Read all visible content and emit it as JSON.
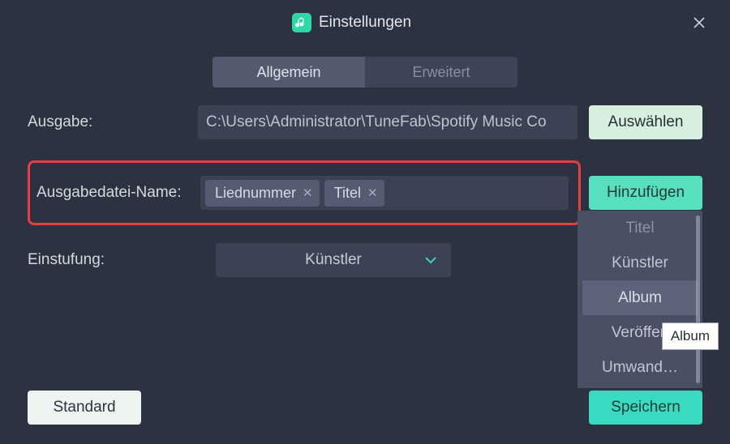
{
  "title": "Einstellungen",
  "tabs": {
    "general": "Allgemein",
    "advanced": "Erweitert"
  },
  "rows": {
    "output_label": "Ausgabe:",
    "output_path": "C:\\Users\\Administrator\\TuneFab\\Spotify Music Co",
    "pick_button": "Auswählen",
    "filename_label": "Ausgabedatei-Name:",
    "tags": {
      "tracknumber": "Liednummer",
      "title": "Titel"
    },
    "add_button": "Hinzufügen",
    "classification_label": "Einstufung:",
    "classification_value": "Künstler"
  },
  "dropdown": {
    "items": [
      "Titel",
      "Künstler",
      "Album",
      "Veröffen",
      "Umwand…"
    ],
    "selected": "Album"
  },
  "tooltip": "Album",
  "footer": {
    "default": "Standard",
    "save": "Speichern"
  }
}
